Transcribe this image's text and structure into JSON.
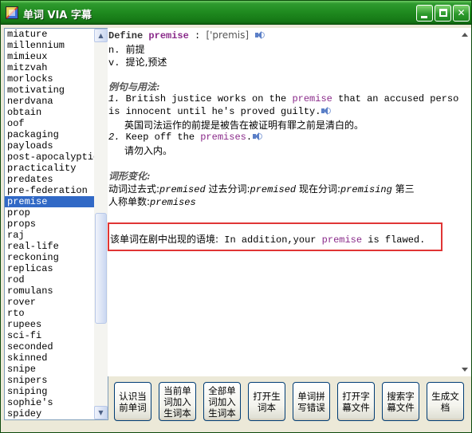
{
  "window": {
    "title": "单词 VIA 字幕",
    "controls": {
      "minimize": "_",
      "maximize": "□",
      "close": "✕"
    }
  },
  "word_list": {
    "items": [
      "miature",
      "millennium",
      "mimieux",
      "mitzvah",
      "morlocks",
      "motivating",
      "nerdvana",
      "obtain",
      "oof",
      "packaging",
      "payloads",
      "post-apocalyptic",
      "practicality",
      "predates",
      "pre-federation",
      "premise",
      "prop",
      "props",
      "raj",
      "real-life",
      "reckoning",
      "replicas",
      "rod",
      "romulans",
      "rover",
      "rto",
      "rupees",
      "sci-fi",
      "seconded",
      "skinned",
      "snipe",
      "snipers",
      "sniping",
      "sophie's",
      "spidey"
    ],
    "selected": "premise",
    "scroll_up": "▲",
    "scroll_down": "▼"
  },
  "entry": {
    "define_label": "Define",
    "word": "premise",
    "phonetic_sep": " :",
    "phonetic": "['premis]",
    "senses": [
      {
        "pos": "n.",
        "meaning": "前提"
      },
      {
        "pos": "v.",
        "meaning": "提论,预述"
      }
    ],
    "examples_title": "例句与用法:",
    "examples": [
      {
        "num": "1.",
        "pre": "British justice works on the ",
        "kw": "premise",
        "post": " that an accused person",
        "line2": "is innocent until he's proved guilty.",
        "cn": "英国司法运作的前提是被告在被证明有罪之前是清白的。"
      },
      {
        "num": "2.",
        "pre": "Keep off the ",
        "kw": "premises",
        "post": ".",
        "line2": "",
        "cn": "请勿入内。"
      }
    ],
    "inflections_title": "词形变化:",
    "inflections_line1": {
      "past_label": "动词过去式:",
      "past": "premised",
      "pp_label": " 过去分词:",
      "pp": "premised",
      "ing_label": " 现在分词:",
      "ing": "premising",
      "tail": " 第三"
    },
    "inflections_line2": {
      "label": "人称单数:",
      "value": "premises"
    },
    "context": {
      "label": "该单词在剧中出现的语境:",
      "pre": " In addition,your ",
      "kw": "premise",
      "post": " is flawed."
    }
  },
  "buttons": [
    {
      "id": "known",
      "label": "认识当前单词"
    },
    {
      "id": "add-current",
      "label": "当前单词加入生词本"
    },
    {
      "id": "add-all",
      "label": "全部单词加入生词本"
    },
    {
      "id": "open-vocab",
      "label": "打开生词本"
    },
    {
      "id": "spell-error",
      "label": "单词拼写错误"
    },
    {
      "id": "open-subtitle",
      "label": "打开字幕文件"
    },
    {
      "id": "search-subtitle",
      "label": "搜索字幕文件"
    },
    {
      "id": "generate-doc",
      "label": "生成文档"
    }
  ]
}
